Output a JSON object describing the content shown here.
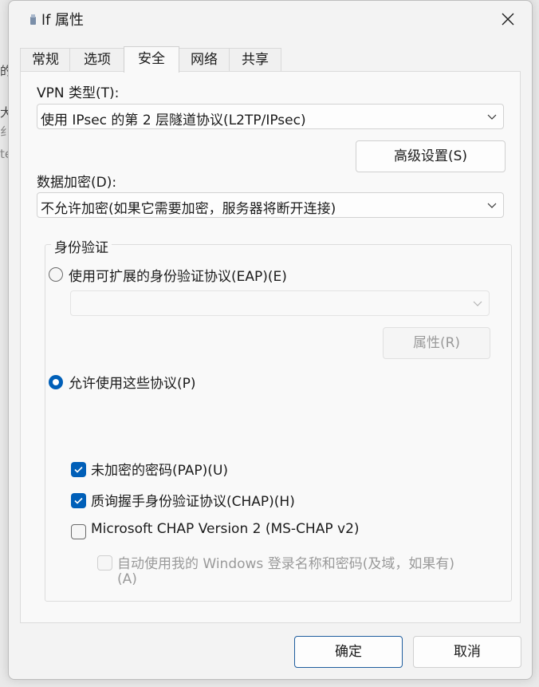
{
  "window": {
    "title": "lf 属性",
    "close_icon": "close-icon"
  },
  "background_glyphs": [
    "的",
    "大",
    "纟",
    "te"
  ],
  "tabs": [
    {
      "label": "常规",
      "active": false
    },
    {
      "label": "选项",
      "active": false
    },
    {
      "label": "安全",
      "active": true
    },
    {
      "label": "网络",
      "active": false
    },
    {
      "label": "共享",
      "active": false
    }
  ],
  "security": {
    "vpn_type_label": "VPN 类型(T):",
    "vpn_type_value": "使用 IPsec 的第 2 层隧道协议(L2TP/IPsec)",
    "advanced_button": "高级设置(S)",
    "encryption_label": "数据加密(D):",
    "encryption_value": "不允许加密(如果它需要加密，服务器将断开连接)",
    "auth": {
      "group_title": "身份验证",
      "eap_radio_label": "使用可扩展的身份验证协议(EAP)(E)",
      "eap_selected": false,
      "eap_select_value": "",
      "properties_button": "属性(R)",
      "allow_radio_label": "允许使用这些协议(P)",
      "allow_selected": true,
      "pap_label": "未加密的密码(PAP)(U)",
      "pap_checked": true,
      "chap_label": "质询握手身份验证协议(CHAP)(H)",
      "chap_checked": true,
      "mschap_label": "Microsoft CHAP Version 2 (MS-CHAP v2)",
      "mschap_checked": false,
      "autologon_label_line1": "自动使用我的 Windows 登录名称和密码(及域，如果有)",
      "autologon_label_line2": "(A)",
      "autologon_checked": false
    }
  },
  "footer": {
    "ok_button": "确定",
    "cancel_button": "取消"
  },
  "colors": {
    "accent": "#005fb8",
    "panel_bg": "#f9f9f9",
    "dialog_bg": "#f3f3f3"
  }
}
